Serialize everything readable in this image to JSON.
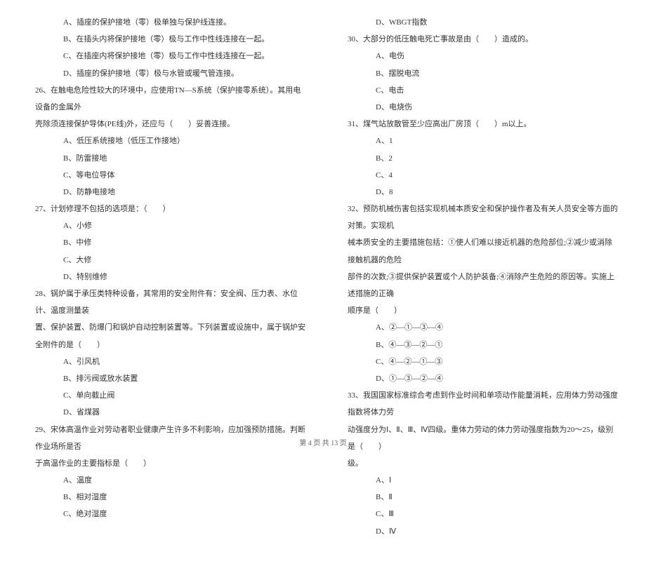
{
  "left": {
    "opt_a_25": "A、插座的保护接地（零）极单独与保护线连接。",
    "opt_b_25": "B、在插头内将保护接地（零）极与工作中性线连接在一起。",
    "opt_c_25": "C、在插座内将保护接地（零）极与工作中性线连接在一起。",
    "opt_d_25": "D、插座的保护接地（零）极与水管或暖气管连接。",
    "q26_1": "26、在触电危险性较大的环境中，应使用TN—S系统（保护接零系统）。其用电设备的金属外",
    "q26_2": "壳除须连接保护导体(PE线)外，还应与（　　）妥善连接。",
    "opt_a_26": "A、低压系统接地（低压工作接地）",
    "opt_b_26": "B、防雷接地",
    "opt_c_26": "C、等电位导体",
    "opt_d_26": "D、防静电接地",
    "q27": "27、计划修理不包括的选项是：（　　）",
    "opt_a_27": "A、小修",
    "opt_b_27": "B、中修",
    "opt_c_27": "C、大修",
    "opt_d_27": "D、特别维修",
    "q28_1": "28、锅炉属于承压类特种设备，其常用的安全附件有：安全阀、压力表、水位计、温度测量装",
    "q28_2": "置、保护装置、防爆门和锅炉自动控制装置等。下列装置或设施中，属于锅炉安全附件的是（　　）",
    "opt_a_28": "A、引风机",
    "opt_b_28": "B、排污阀或放水装置",
    "opt_c_28": "C、单向截止阀",
    "opt_d_28": "D、省煤器",
    "q29_1": "29、宋体高温作业对劳动者职业健康产生许多不利影响，应加强预防措施。判断作业场所是否",
    "q29_2": "于高温作业的主要指标是（　　）",
    "opt_a_29": "A、温度",
    "opt_b_29": "B、相对湿度",
    "opt_c_29": "C、绝对湿度"
  },
  "right": {
    "opt_d_29": "D、WBGT指数",
    "q30": "30、大部分的低压触电死亡事故是由（　　）造成的。",
    "opt_a_30": "A、电伤",
    "opt_b_30": "B、摆脱电流",
    "opt_c_30": "C、电击",
    "opt_d_30": "D、电烧伤",
    "q31": "31、煤气站放散管至少应高出厂房顶（　　）m以上。",
    "opt_a_31": "A、1",
    "opt_b_31": "B、2",
    "opt_c_31": "C、4",
    "opt_d_31": "D、8",
    "q32_1": "32、预防机械伤害包括实现机械本质安全和保护操作者及有关人员安全等方面的对策。实现机",
    "q32_2": "械本质安全的主要措施包括：①使人们难以接近机器的危险部位;②减少或消除接触机器的危险",
    "q32_3": "部件的次数;③提供保护装置或个人防护装备;④消除产生危险的原因等。实施上述措施的正确",
    "q32_4": "顺序是（　　）",
    "opt_a_32": "A、②—①—③—④",
    "opt_b_32": "B、④—③—②—①",
    "opt_c_32": "C、④—②—①—③",
    "opt_d_32": "D、①—③—②—④",
    "q33_1": "33、我国国家标准综合考虑到作业时间和单项动作能量消耗，应用体力劳动强度指数将体力劳",
    "q33_2": "动强度分为Ⅰ、Ⅱ、Ⅲ、Ⅳ四级。重体力劳动的体力劳动强度指数为20～25，级别是（　　）",
    "q33_3": "级。",
    "opt_a_33": "A、Ⅰ",
    "opt_b_33": "B、Ⅱ",
    "opt_c_33": "C、Ⅲ",
    "opt_d_33": "D、Ⅳ"
  },
  "footer": "第 4 页 共 13 页"
}
